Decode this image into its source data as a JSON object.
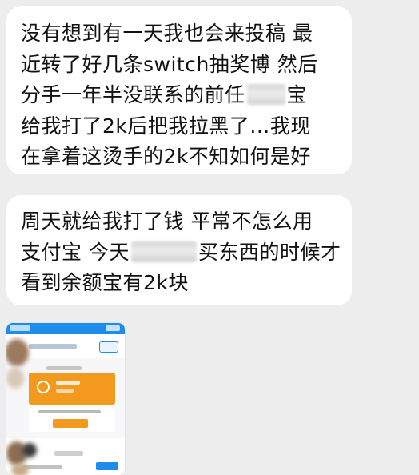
{
  "messages": [
    {
      "lines": [
        [
          "没有想到有一天我也会来投稿 最"
        ],
        [
          "近转了好几条switch抽奖博 然后"
        ],
        [
          "分手一年半没联系的前任",
          "宝"
        ],
        [
          "给我打了2k后把我拉黑了...我现"
        ],
        [
          "在拿着这烫手的2k不知如何是好"
        ]
      ]
    },
    {
      "lines": [
        [
          "周天就给我打了钱 平常不怎么用"
        ],
        [
          "支付宝 今天",
          "买东西的时候才"
        ],
        [
          "看到余额宝有2k块"
        ]
      ]
    }
  ],
  "image_message": {
    "type": "image"
  },
  "colors": {
    "background": "#ededed",
    "bubble": "#ffffff",
    "text": "#111111",
    "alipay_blue": "#1e8ceb",
    "orange": "#f39a1e"
  }
}
